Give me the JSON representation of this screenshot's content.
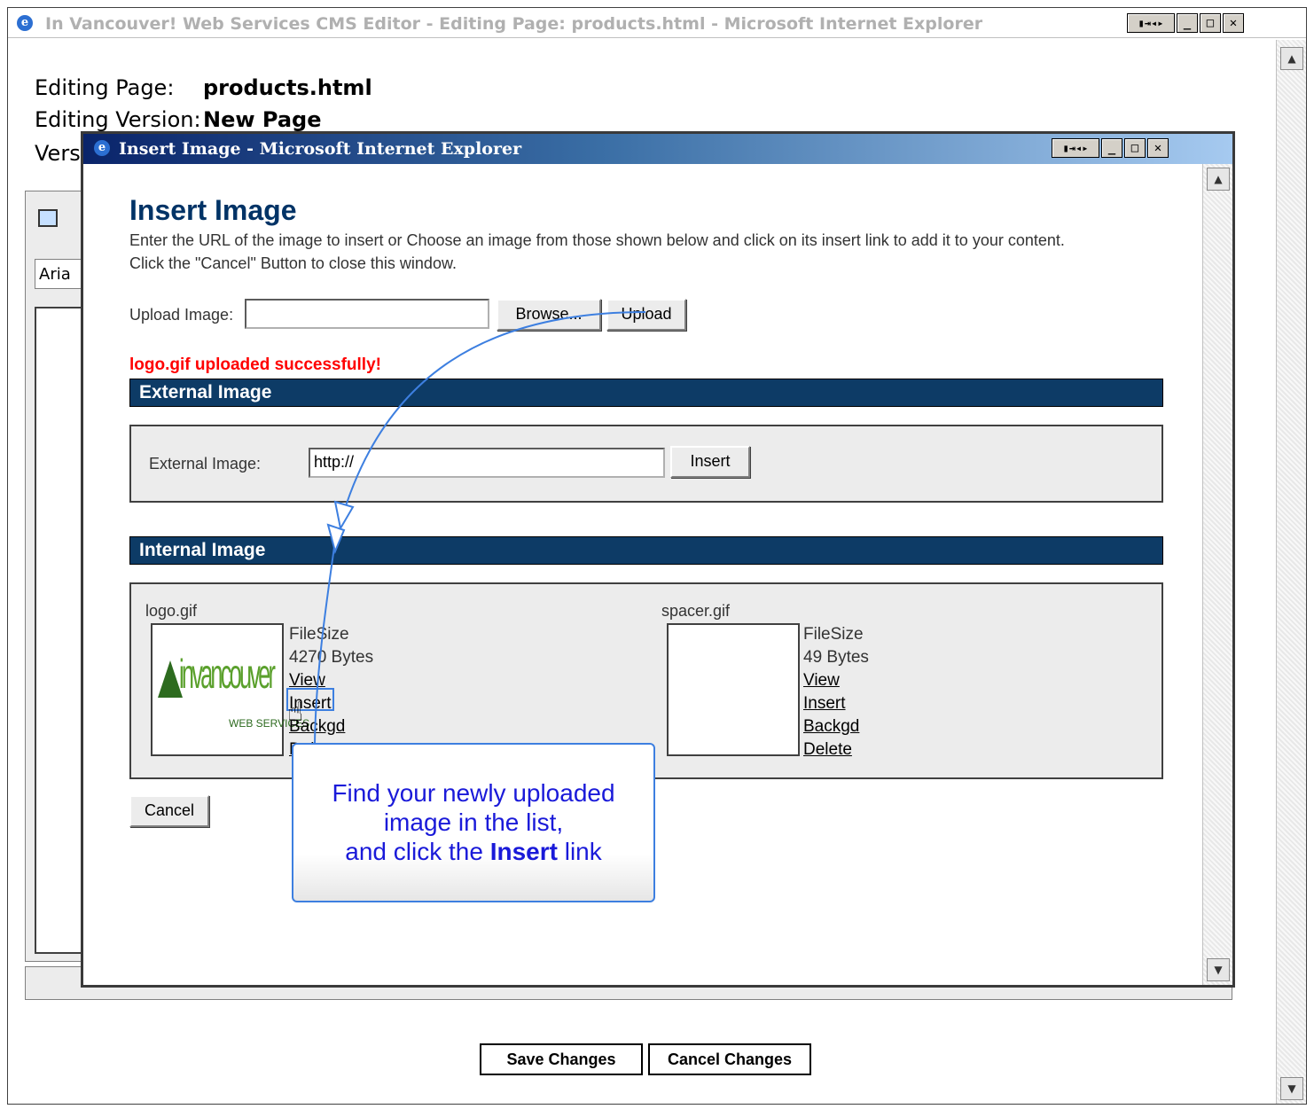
{
  "outer_window": {
    "title": "In Vancouver! Web Services CMS Editor - Editing Page: products.html - Microsoft Internet Explorer",
    "buttons": {
      "back_fwd": "▮⧉◂▸⧉",
      "minimize": "_",
      "maximize": "□",
      "close": "✕"
    }
  },
  "editor": {
    "editing_page_label": "Editing Page:",
    "editing_page_value": "products.html",
    "editing_version_label": "Editing Version:",
    "editing_version_value": "New Page",
    "version_label_partial": "Vers",
    "font_partial": "Aria",
    "save_changes": "Save Changes",
    "cancel_changes": "Cancel Changes"
  },
  "dialog": {
    "title": "Insert Image - Microsoft Internet Explorer",
    "heading": "Insert Image",
    "instructions_line1": "Enter the URL of the image to insert or Choose an image from those shown below and click on its insert link to add it to your content.",
    "instructions_line2": "Click the \"Cancel\" Button to close this window.",
    "upload_label": "Upload Image:",
    "upload_value": "",
    "browse_button": "Browse...",
    "upload_button": "Upload",
    "success_message": "logo.gif uploaded successfully!",
    "external_section": "External Image",
    "external_label": "External Image:",
    "external_value": "http://",
    "external_insert": "Insert",
    "internal_section": "Internal Image",
    "images": [
      {
        "name": "logo.gif",
        "filesize_label": "FileSize",
        "filesize_value": "4270 Bytes",
        "links": [
          "View",
          "Insert",
          "Backgd",
          "Delete"
        ],
        "logo_text": "invancouver",
        "logo_sub": "WEB SERVICES"
      },
      {
        "name": "spacer.gif",
        "filesize_label": "FileSize",
        "filesize_value": "49 Bytes",
        "links": [
          "View",
          "Insert",
          "Backgd",
          "Delete"
        ]
      }
    ],
    "cancel_button": "Cancel"
  },
  "callout": {
    "line1": "Find your newly uploaded",
    "line2": "image in the list,",
    "line3_prefix": "and click the ",
    "line3_bold": "Insert",
    "line3_suffix": " link"
  },
  "colors": {
    "section_bar": "#0d3b66",
    "success": "#ff0000",
    "callout_text": "#1a1ad9",
    "callout_border": "#3d7fe0"
  }
}
